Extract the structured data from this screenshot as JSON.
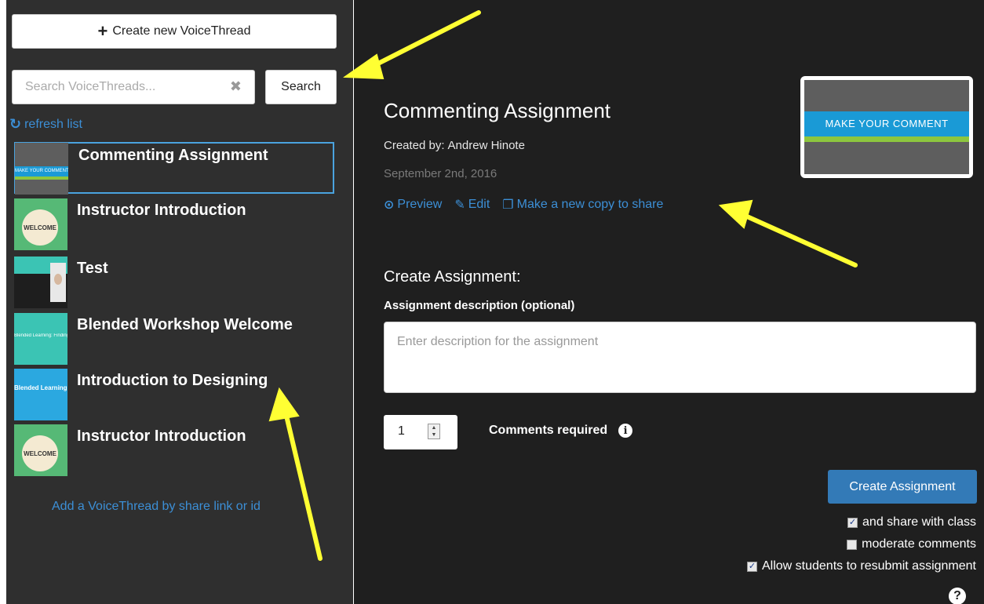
{
  "sidebar": {
    "create_button_label": "Create new VoiceThread",
    "search_placeholder": "Search VoiceThreads...",
    "search_button_label": "Search",
    "refresh_label": "refresh list",
    "items": [
      {
        "title": "Commenting Assignment",
        "thumb_text": "MAKE YOUR COMMENT",
        "selected": true
      },
      {
        "title": "Instructor Introduction",
        "thumb_text": "WELCOME"
      },
      {
        "title": "Test"
      },
      {
        "title": "Blended Workshop Welcome",
        "thumb_text": "Blended Learning: Finding the Middle"
      },
      {
        "title": "Introduction to Designing",
        "thumb_text": "Blended Learning: Finding the Middle"
      },
      {
        "title": "Instructor Introduction",
        "thumb_text": "WELCOME"
      }
    ],
    "add_link_label": "Add a VoiceThread by share link or id"
  },
  "main": {
    "title": "Commenting Assignment",
    "created_by_label": "Created by:",
    "author": "Andrew Hinote",
    "date": "September 2nd, 2016",
    "actions": {
      "preview": "Preview",
      "edit": "Edit",
      "copy": "Make a new copy to share"
    },
    "preview_banner": "MAKE YOUR COMMENT",
    "create_heading": "Create Assignment:",
    "description_label": "Assignment description (optional)",
    "description_placeholder": "Enter description for the assignment",
    "comments_required_value": "1",
    "comments_required_label": "Comments required",
    "create_button_label": "Create Assignment",
    "options": [
      {
        "label": "and share with class",
        "checked": true
      },
      {
        "label": "moderate comments",
        "checked": false
      },
      {
        "label": "Allow students to resubmit assignment",
        "checked": true
      }
    ]
  },
  "colors": {
    "accent": "#337ab7",
    "link": "#3c8fd6",
    "annotation_arrow": "#ffff33"
  }
}
